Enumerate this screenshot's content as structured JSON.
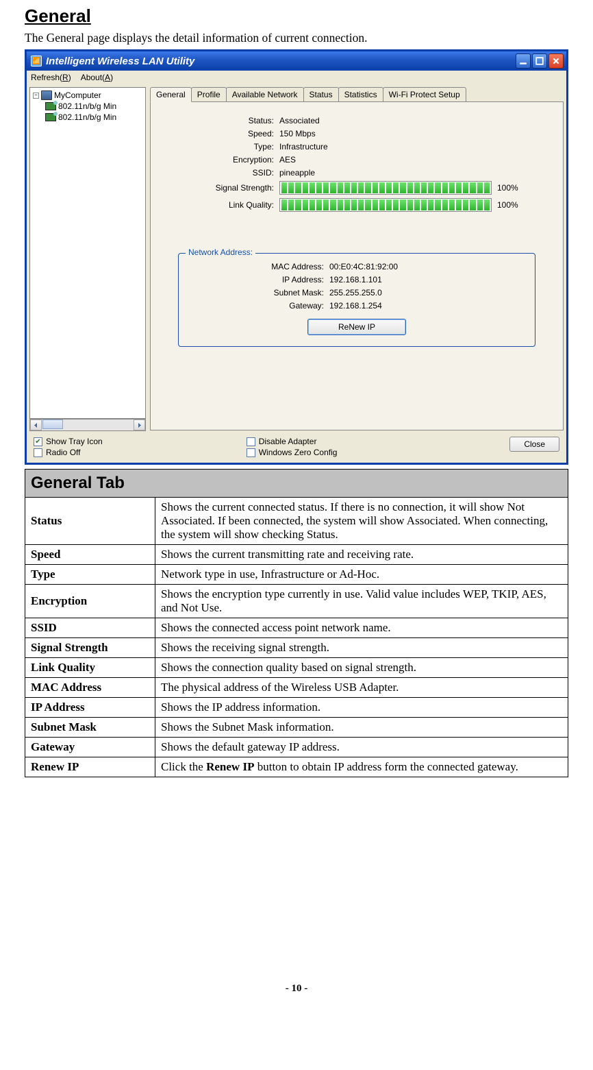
{
  "page": {
    "heading": "General",
    "intro": "The General page displays the detail information of current connection.",
    "page_number": "- 10 -"
  },
  "window": {
    "title": "Intelligent Wireless LAN Utility",
    "menu": {
      "refresh": "Refresh(R)",
      "about": "About(A)"
    },
    "tree": {
      "root": "MyComputer",
      "items": [
        "802.11n/b/g Min",
        "802.11n/b/g Min"
      ]
    },
    "tabs": [
      "General",
      "Profile",
      "Available Network",
      "Status",
      "Statistics",
      "Wi-Fi Protect Setup"
    ],
    "info": {
      "status_label": "Status:",
      "status_value": "Associated",
      "speed_label": "Speed:",
      "speed_value": "150 Mbps",
      "type_label": "Type:",
      "type_value": "Infrastructure",
      "encryption_label": "Encryption:",
      "encryption_value": "AES",
      "ssid_label": "SSID:",
      "ssid_value": "pineapple",
      "signal_label": "Signal Strength:",
      "signal_pct": "100%",
      "link_label": "Link Quality:",
      "link_pct": "100%"
    },
    "network_group": {
      "legend": "Network Address:",
      "mac_label": "MAC Address:",
      "mac_value": "00:E0:4C:81:92:00",
      "ip_label": "IP Address:",
      "ip_value": "192.168.1.101",
      "subnet_label": "Subnet Mask:",
      "subnet_value": "255.255.255.0",
      "gateway_label": "Gateway:",
      "gateway_value": "192.168.1.254",
      "renew_button": "ReNew IP"
    },
    "bottom": {
      "show_tray": "Show Tray Icon",
      "radio_off": "Radio Off",
      "disable_adapter": "Disable Adapter",
      "windows_zero": "Windows Zero Config",
      "close": "Close"
    }
  },
  "table": {
    "header": "General Tab",
    "rows": [
      {
        "key": "Status",
        "desc": "Shows the current connected status. If there is no connection, it will show Not Associated. If been connected, the system will show Associated. When connecting, the system will show checking Status."
      },
      {
        "key": "Speed",
        "desc": "Shows the current transmitting rate and receiving rate."
      },
      {
        "key": "Type",
        "desc": "Network type in use, Infrastructure or Ad-Hoc."
      },
      {
        "key": "Encryption",
        "desc": "Shows the encryption type currently in use. Valid value includes WEP, TKIP, AES, and Not Use."
      },
      {
        "key": "SSID",
        "desc": "Shows the connected access point network name."
      },
      {
        "key": "Signal Strength",
        "desc": "Shows the receiving signal strength."
      },
      {
        "key": "Link Quality",
        "desc": "Shows the connection quality based on signal strength."
      },
      {
        "key": "MAC Address",
        "desc": "The physical address of the Wireless USB Adapter."
      },
      {
        "key": "IP Address",
        "desc": "Shows the IP address information."
      },
      {
        "key": "Subnet Mask",
        "desc": "Shows the Subnet Mask information."
      },
      {
        "key": "Gateway",
        "desc": "Shows the default gateway IP address."
      },
      {
        "key": "Renew IP",
        "desc": "Click the Renew IP button to obtain IP address form the connected gateway."
      }
    ]
  }
}
